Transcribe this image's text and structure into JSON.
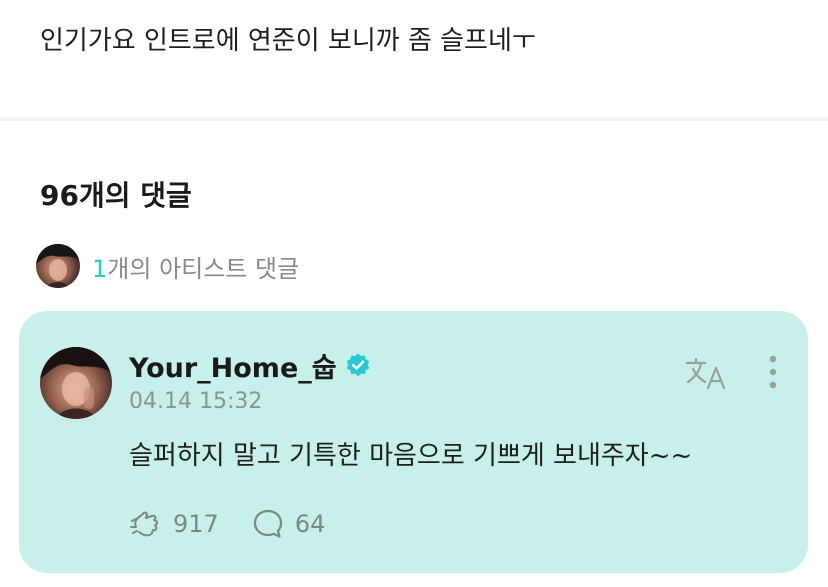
{
  "post": {
    "text": "인기가요 인트로에 연준이 보니까 좀 슬프네ㅜ"
  },
  "comments_section": {
    "heading": "96개의 댓글",
    "artist_summary": {
      "count": "1",
      "label_rest": "개의 아티스트 댓글"
    }
  },
  "artist_comment": {
    "author": "Your_Home_숩",
    "timestamp": "04.14 15:32",
    "body": "슬퍼하지 말고 기특한 마음으로 기쁘게 보내주자~~",
    "likes": "917",
    "replies": "64"
  },
  "icons": {
    "verified": "verified-check-icon",
    "translate": "translate-icon",
    "more": "more-vertical-icon",
    "like": "like-hand-icon",
    "reply": "speech-bubble-icon"
  },
  "colors": {
    "card_background": "#c8f0ea",
    "accent": "#2ac8d2",
    "muted_text": "#8a8a8e"
  }
}
